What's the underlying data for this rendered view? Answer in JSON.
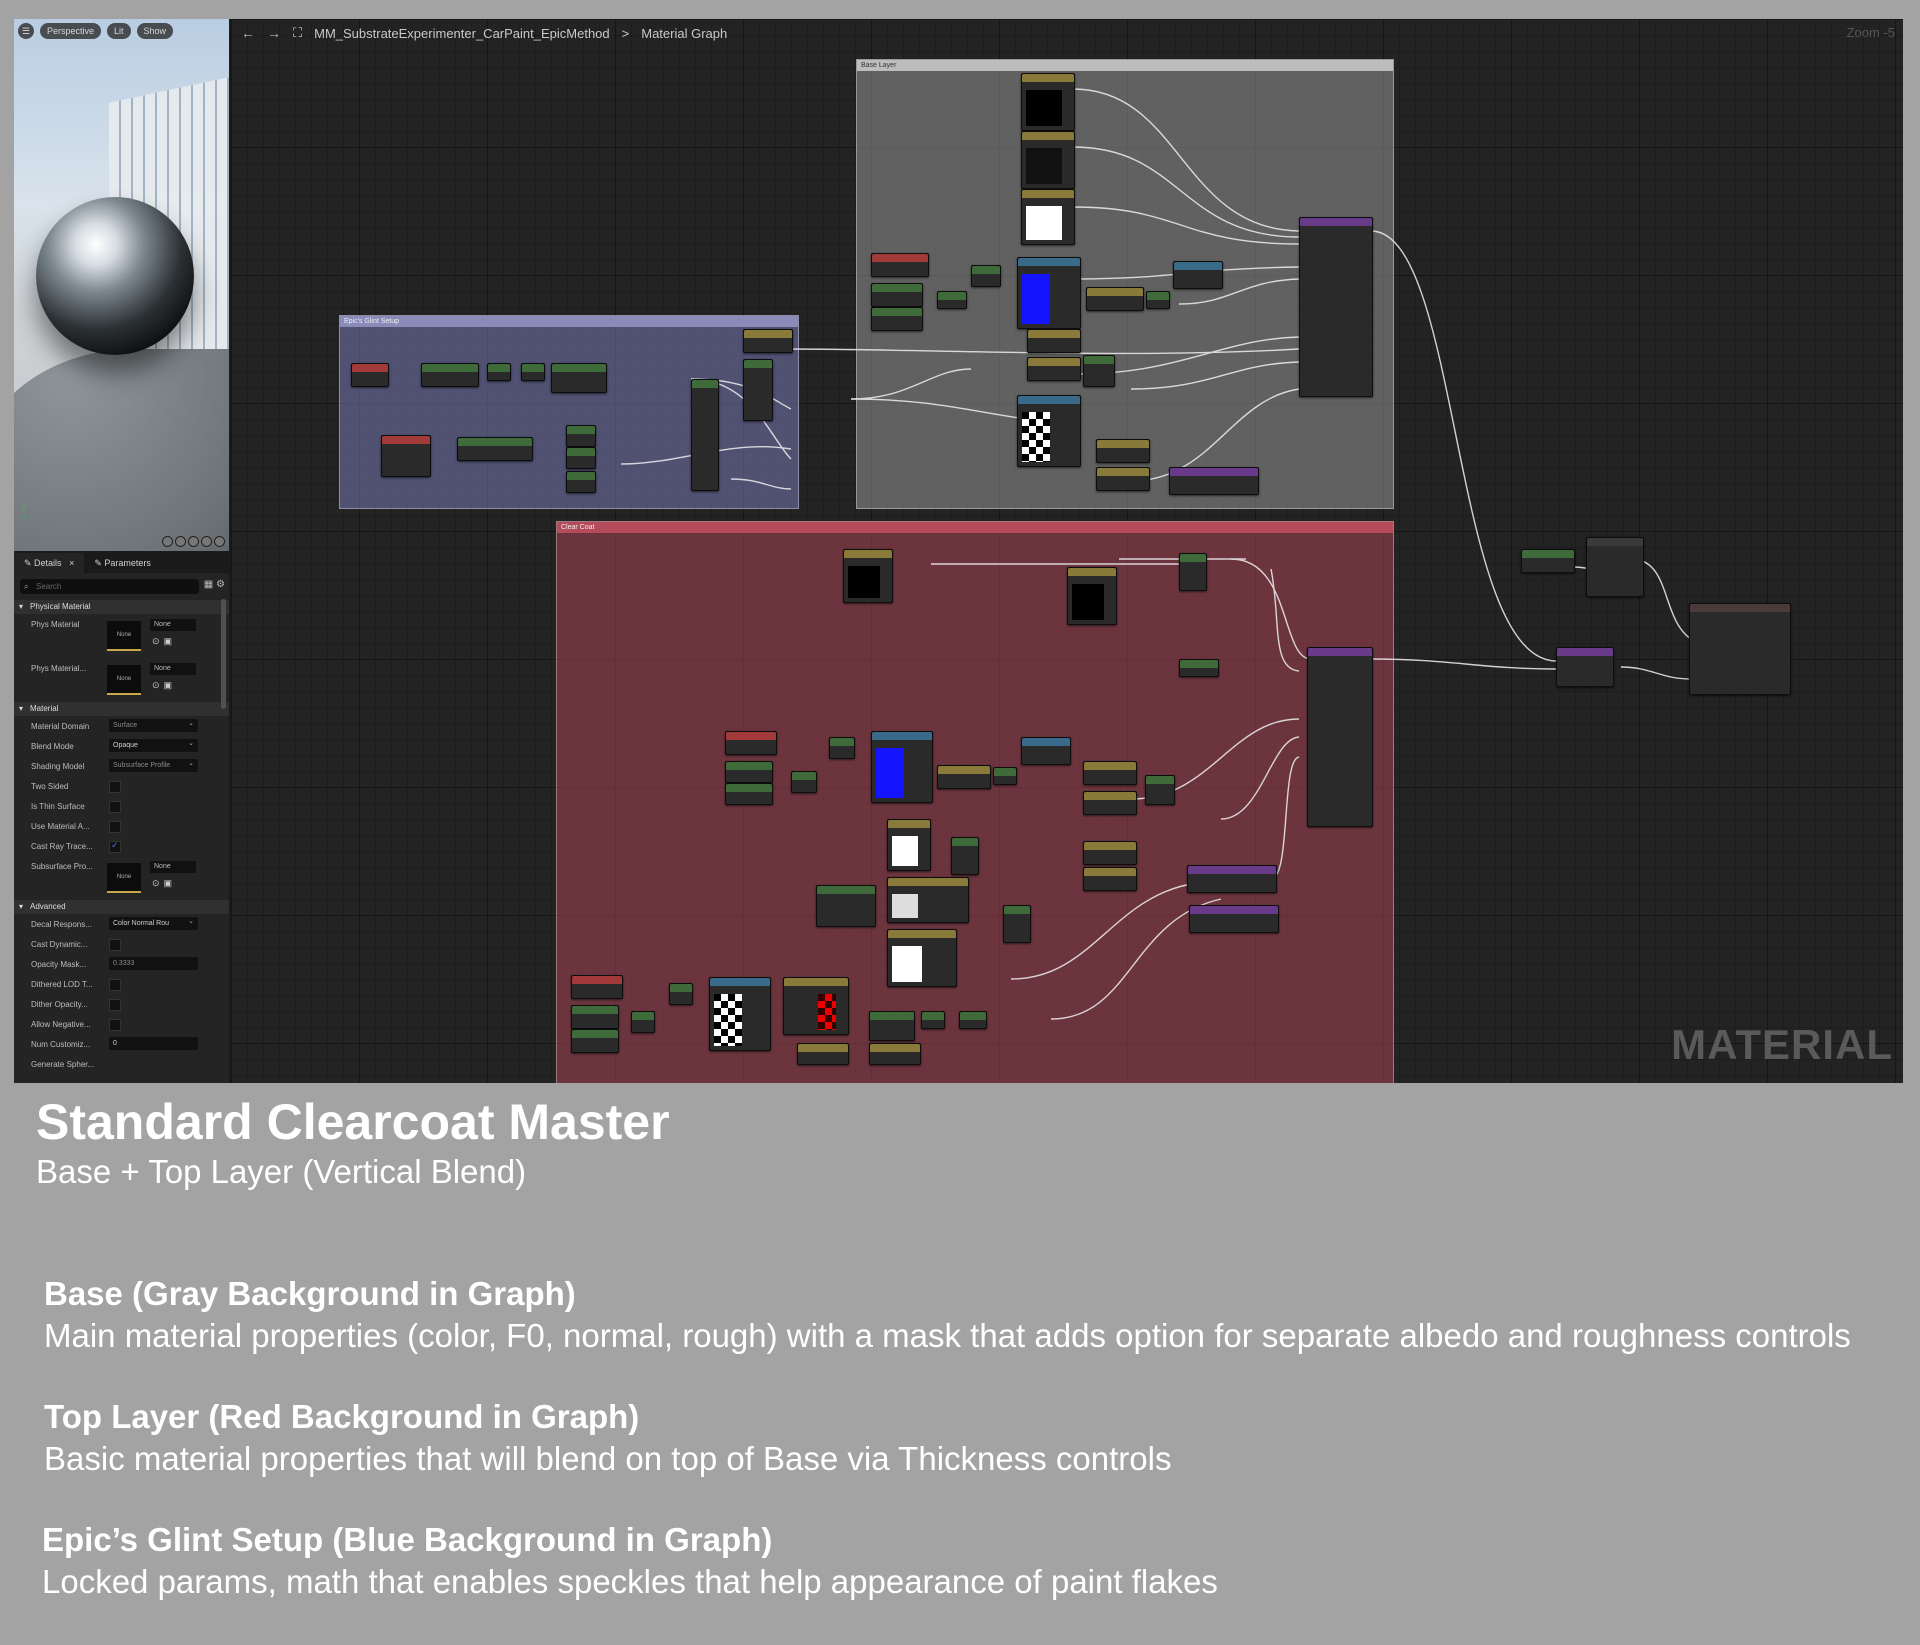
{
  "viewport": {
    "menu_icon": "menu-icon",
    "perspective_label": "Perspective",
    "lit_label": "Lit",
    "show_label": "Show"
  },
  "details": {
    "tab_details": "Details",
    "tab_parameters": "Parameters",
    "search_placeholder": "Search",
    "sections": {
      "physical_material": "Physical Material",
      "material": "Material",
      "advanced": "Advanced"
    },
    "phys_material_label": "Phys Material",
    "phys_material_value": "None",
    "phys_material_dropdown": "None",
    "phys_material_mask_label": "Phys Material...",
    "phys_material_mask_value": "None",
    "phys_material_mask_dropdown": "None",
    "material_domain_label": "Material Domain",
    "material_domain_value": "Surface",
    "blend_mode_label": "Blend Mode",
    "blend_mode_value": "Opaque",
    "shading_model_label": "Shading Model",
    "shading_model_value": "Subsurface Profile",
    "two_sided_label": "Two Sided",
    "thin_surface_label": "Is Thin Surface",
    "use_material_label": "Use Material A...",
    "cast_ray_label": "Cast Ray Trace...",
    "subsurface_label": "Subsurface Pro...",
    "subsurface_value": "None",
    "subsurface_dropdown": "None",
    "decal_label": "Decal Respons...",
    "decal_value": "Color Normal Rou",
    "cast_dynamic_label": "Cast Dynamic...",
    "opacity_mask_label": "Opacity Mask...",
    "opacity_mask_value": "0.3333",
    "dithered_lod_label": "Dithered LOD T...",
    "dither_opacity_label": "Dither Opacity...",
    "allow_negative_label": "Allow Negative...",
    "num_customized_label": "Num Customiz...",
    "num_customized_value": "0",
    "generate_label": "Generate Spher..."
  },
  "graph": {
    "back_icon": "back-arrow-icon",
    "forward_icon": "forward-arrow-icon",
    "breadcrumb_asset": "MM_SubstrateExperimenter_CarPaint_EpicMethod",
    "breadcrumb_separator": ">",
    "breadcrumb_current": "Material Graph",
    "zoom_label": "Zoom -5",
    "comment_base": "Base Layer",
    "comment_glint": "Epic's Glint Setup",
    "comment_coat": "Clear Coat",
    "watermark": "MATERIAL"
  },
  "captions": {
    "title": "Standard Clearcoat Master",
    "subtitle": "Base + Top Layer (Vertical Blend)",
    "sections": [
      {
        "heading": "Base (Gray Background in Graph)",
        "body": "Main material properties (color, F0, normal, rough) with a mask that adds option for separate albedo and roughness controls"
      },
      {
        "heading": "Top Layer (Red Background in Graph)",
        "body": "Basic material properties that will blend on top of Base via Thickness controls"
      },
      {
        "heading": "Epic’s Glint Setup (Blue Background in Graph)",
        "body": "Locked params, math that enables speckles that help appearance of paint flakes"
      }
    ]
  },
  "colors": {
    "page_background": "#a3a3a3",
    "graph_background": "#232323",
    "base_comment": "#969696",
    "glint_comment": "#7878b4",
    "coat_comment": "#aa4655",
    "param_header": "#8a7a3a",
    "texture_header": "#a23a3a",
    "substrate_header": "#6a3a8a",
    "math_header": "#3f6a3a",
    "wire": "#e8e8e8"
  }
}
